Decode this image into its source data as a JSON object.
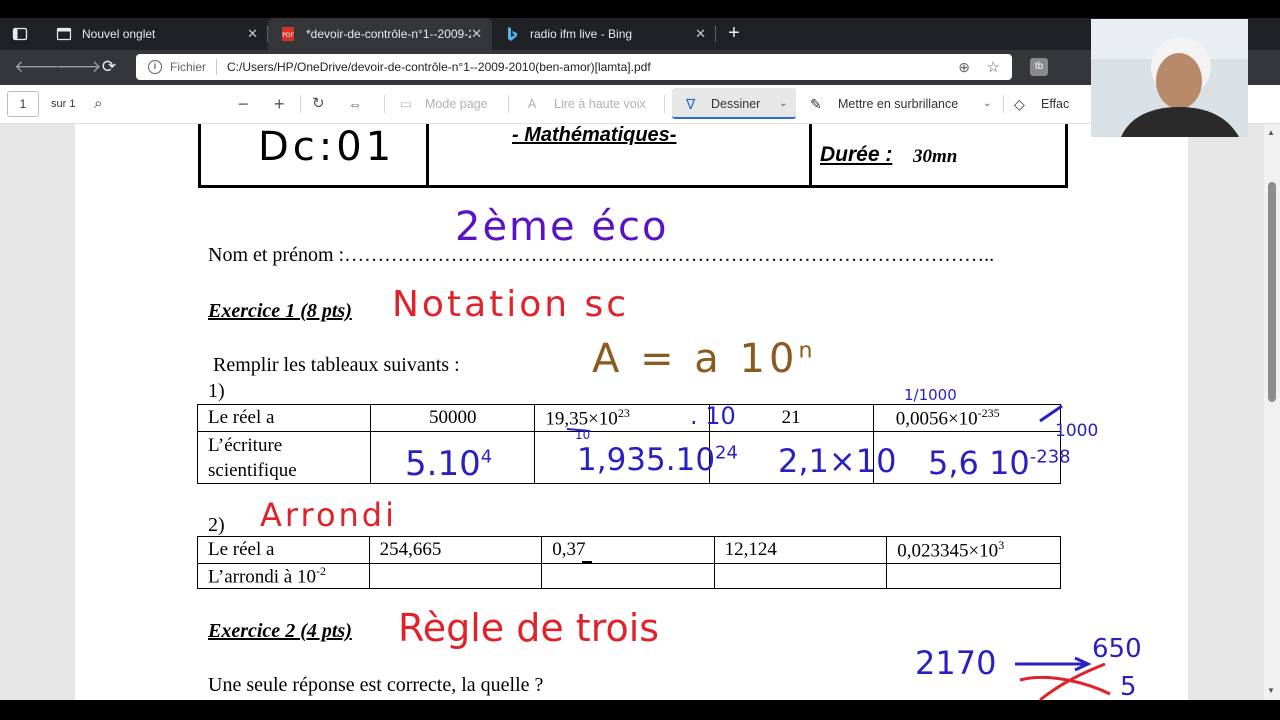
{
  "browser": {
    "tabs": [
      {
        "label": "Nouvel onglet",
        "icon": "new-tab-page-icon"
      },
      {
        "label": "*devoir-de-contrôle-n°1--2009-2",
        "icon": "pdf-icon"
      },
      {
        "label": "radio ifm live - Bing",
        "icon": "bing-icon"
      }
    ],
    "new_tab": "+",
    "close": "✕",
    "address": {
      "scheme_label": "Fichier",
      "url": "C:/Users/HP/OneDrive/devoir-de-contrôle-n°1--2009-2010(ben-amor)[lamta].pdf"
    },
    "extension_label": "tb"
  },
  "pdf_toolbar": {
    "page_number": "1",
    "page_total": "sur 1",
    "mode_page": "Mode page",
    "read_aloud": "Lire à haute voix",
    "draw": "Dessiner",
    "highlight": "Mettre en surbrillance",
    "erase": "Effac"
  },
  "document": {
    "header_code": "Dc:01",
    "subject": "- Mathématiques-",
    "duration_label": "Durée :",
    "duration_value": "30mn",
    "name_line": "Nom et prénom :……………………………………………………………………………………..",
    "ex1_title": "Exercice 1 (8 pts)",
    "ex1_instruction": "Remplir les tableaux suivants :",
    "part1": "1)",
    "table1": {
      "row1_label": "Le réel a",
      "row2_label": "L’écriture scientifique",
      "values": [
        "50000",
        "19,35×10",
        "21",
        "0,0056×10"
      ],
      "exp2": "23",
      "exp4": "-235"
    },
    "part2": "2)",
    "table2": {
      "row1_label": "Le réel a",
      "row2_label": "L’arrondi à 10",
      "row2_exp": "-2",
      "values": [
        "254,665",
        "0,37",
        "12,124",
        "0,023345×10"
      ],
      "exp4": "3"
    },
    "ex2_title": "Exercice 2 (4 pts)",
    "ex2_question": "Une seule réponse est correcte, la quelle ?"
  },
  "annotations": {
    "level": "2ème éco",
    "notation": "Notation sc",
    "formula": "A = a 10",
    "formula_exp": "n",
    "ans1": "5.10",
    "ans1_exp": "4",
    "mult": ". 10",
    "ans2": "1,935.10",
    "ans2_exp": "24",
    "ans3": "2,1×10",
    "ans4": "5,6 10",
    "ans4_exp": "-238",
    "note_1000_a": "1/1000",
    "note_1000_b": "1000",
    "note_10": "10",
    "arrondi": "Arrondi",
    "regle": "Règle de trois",
    "calc_a": "2170",
    "calc_b": "650",
    "calc_c": "5"
  },
  "colors": {
    "red_ink": "#e0222a",
    "blue_ink": "#2a1fbf",
    "brown_ink": "#8a5a1f",
    "purple_ink": "#5a12c8",
    "accent": "#2a6cc7"
  }
}
